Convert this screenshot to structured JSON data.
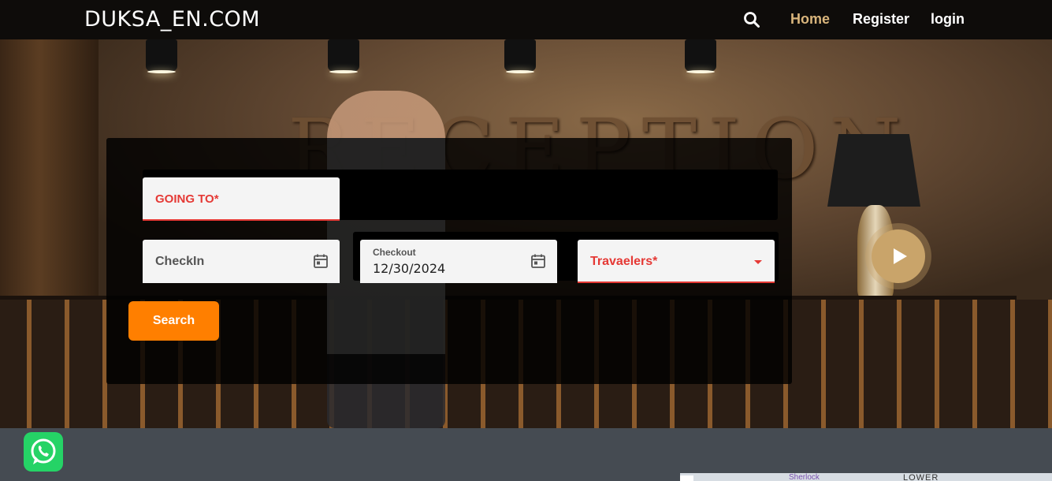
{
  "nav": {
    "brand": "DUKSA_EN.COM",
    "search_icon": "search-icon",
    "links": {
      "home": "Home",
      "register": "Register",
      "login": "login"
    },
    "active_color": "#d9b57c"
  },
  "hero": {
    "background_text": "RECEPTION",
    "play_icon": "play-icon",
    "accent_color": "#c9a46a"
  },
  "search_form": {
    "destination_label": "GOING TO*",
    "checkin_label": "CheckIn",
    "checkout_label": "Checkout",
    "checkout_value": "12/30/2024",
    "travelers_label": "Travaelers*",
    "search_button": "Search",
    "button_color": "#ff7f00",
    "required_color": "#e53935"
  },
  "footer": {
    "whatsapp_icon": "whatsapp-icon",
    "map_text": "LOWER",
    "map_place": "Sherlock"
  }
}
